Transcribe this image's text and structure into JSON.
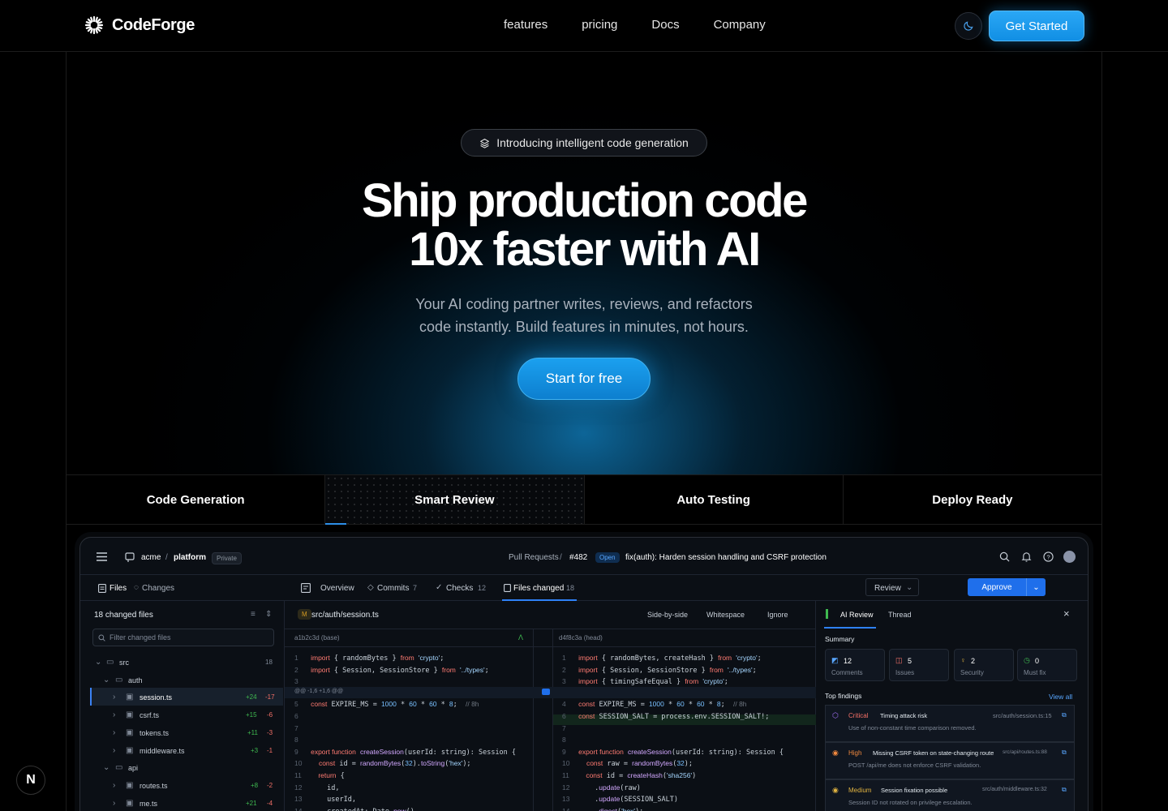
{
  "brand": {
    "name": "CodeForge"
  },
  "nav": {
    "links": [
      "features",
      "pricing",
      "Docs",
      "Company"
    ],
    "cta": "Get Started"
  },
  "hero": {
    "pill": "Introducing intelligent code generation",
    "title_line1": "Ship production code",
    "title_line2": "10x faster with AI",
    "subtitle_line1": "Your AI coding partner writes, reviews, and refactors",
    "subtitle_line2": "code instantly. Build features in minutes, not hours.",
    "cta": "Start for free"
  },
  "feature_tabs": [
    "Code Generation",
    "Smart Review",
    "Auto Testing",
    "Deploy Ready"
  ],
  "app": {
    "org": "acme",
    "repo": "platform",
    "visibility": "Private",
    "breadcrumb_prs": "Pull Requests",
    "pr_number": "#482",
    "pr_state": "Open",
    "pr_title": "fix(auth): Harden session handling and CSRF protection",
    "sidebar_tabs": {
      "files": "Files",
      "changes": "Changes"
    },
    "pr_tabs": {
      "overview": "Overview",
      "commits": "Commits",
      "commits_count": "7",
      "checks": "Checks",
      "checks_count": "12",
      "files": "Files changed",
      "files_count": "18"
    },
    "review_btn": "Review",
    "approve_btn": "Approve",
    "files_panel": {
      "header": "18 changed files",
      "filter_placeholder": "Filter changed files",
      "tree": [
        {
          "name": "src",
          "count": "18"
        },
        {
          "name": "auth"
        },
        {
          "name": "session.ts",
          "add": "+24",
          "del": "-17"
        },
        {
          "name": "csrf.ts",
          "add": "+15",
          "del": "-6"
        },
        {
          "name": "tokens.ts",
          "add": "+11",
          "del": "-3"
        },
        {
          "name": "middleware.ts",
          "add": "+3",
          "del": "-1"
        },
        {
          "name": "api"
        },
        {
          "name": "routes.ts",
          "add": "+8",
          "del": "-2"
        },
        {
          "name": "me.ts",
          "add": "+21",
          "del": "-4"
        }
      ]
    },
    "diff": {
      "file_badge": "M",
      "file": "src/auth/session.ts",
      "opts": [
        "Side-by-side",
        "Whitespace",
        "Ignore"
      ],
      "base": "a1b2c3d (base)",
      "head": "d4f8c3a (head)",
      "hunk": "@@ -1,6 +1,6 @@"
    },
    "review": {
      "tabs": [
        "AI Review",
        "Thread"
      ],
      "summary": "Summary",
      "cards": [
        {
          "value": "12",
          "label": "Comments"
        },
        {
          "value": "5",
          "label": "Issues"
        },
        {
          "value": "2",
          "label": "Security"
        },
        {
          "value": "0",
          "label": "Must fix"
        }
      ],
      "top_findings": "Top findings",
      "view_all": "View all",
      "findings": [
        {
          "severity": "Critical",
          "title": "Timing attack risk",
          "path": "src/auth/session.ts:15",
          "desc": "Use of non-constant time comparison removed."
        },
        {
          "severity": "High",
          "title": "Missing CSRF token on state-changing route",
          "path": "src/api/routes.ts:88",
          "desc": "POST /api/me does not enforce CSRF validation."
        },
        {
          "severity": "Medium",
          "title": "Session fixation possible",
          "path": "src/auth/middleware.ts:32",
          "desc": "Session ID not rotated on privilege escalation."
        }
      ]
    }
  },
  "corner_badge": "N",
  "colors": {
    "accent": "#1a9ff0",
    "critical": "#f47067",
    "high": "#f0883e",
    "medium": "#e0b341"
  }
}
